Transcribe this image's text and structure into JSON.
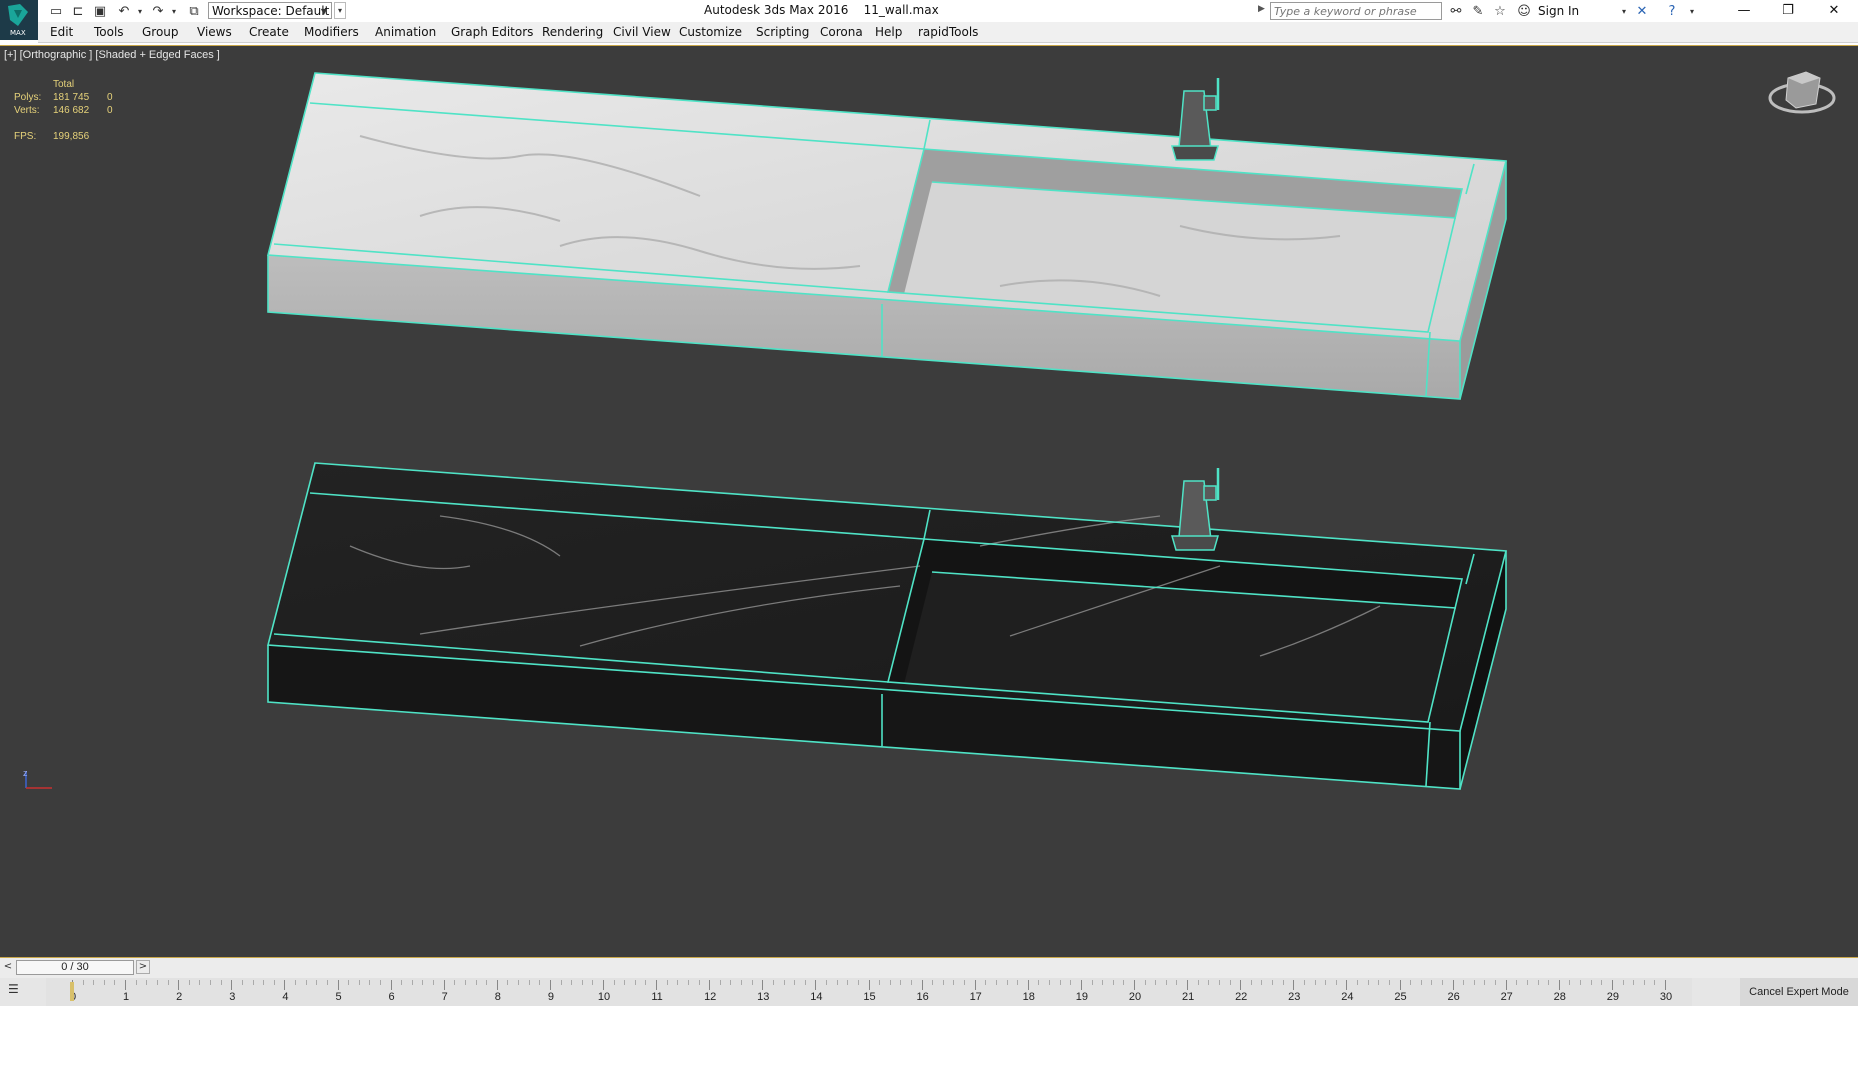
{
  "title_bar": {
    "window_title": "Autodesk 3ds Max 2016",
    "file_name": "11_wall.max",
    "workspace": "Workspace: Default",
    "search_placeholder": "Type a keyword or phrase",
    "sign_in": "Sign In",
    "logo_text": "MAX"
  },
  "menu": {
    "items": [
      "Edit",
      "Tools",
      "Group",
      "Views",
      "Create",
      "Modifiers",
      "Animation",
      "Graph Editors",
      "Rendering",
      "Civil View",
      "Customize",
      "Scripting",
      "Corona",
      "Help",
      "rapidTools"
    ]
  },
  "viewport": {
    "label": "[+] [Orthographic ] [Shaded + Edged Faces ]",
    "stats": {
      "header": "Total",
      "polys_label": "Polys:",
      "polys_value": "181 745",
      "polys_sel": "0",
      "verts_label": "Verts:",
      "verts_value": "146 682",
      "verts_sel": "0",
      "fps_label": "FPS:",
      "fps_value": "199,856"
    },
    "axis_label": "z"
  },
  "timeline": {
    "frame_display": "0 / 30",
    "current_frame": 0,
    "ticks": [
      "0",
      "1",
      "2",
      "3",
      "4",
      "5",
      "6",
      "7",
      "8",
      "9",
      "10",
      "11",
      "12",
      "13",
      "14",
      "15",
      "16",
      "17",
      "18",
      "19",
      "20",
      "21",
      "22",
      "23",
      "24",
      "25",
      "26",
      "27",
      "28",
      "29",
      "30"
    ],
    "cancel_expert": "Cancel Expert Mode",
    "prev_symbol": "<",
    "next_symbol": ">"
  },
  "colors": {
    "viewport_bg": "#3c3c3c",
    "selection_edge": "#4fe3c6",
    "stats_text": "#e6d27a",
    "frame_marker": "#d8c06a"
  }
}
